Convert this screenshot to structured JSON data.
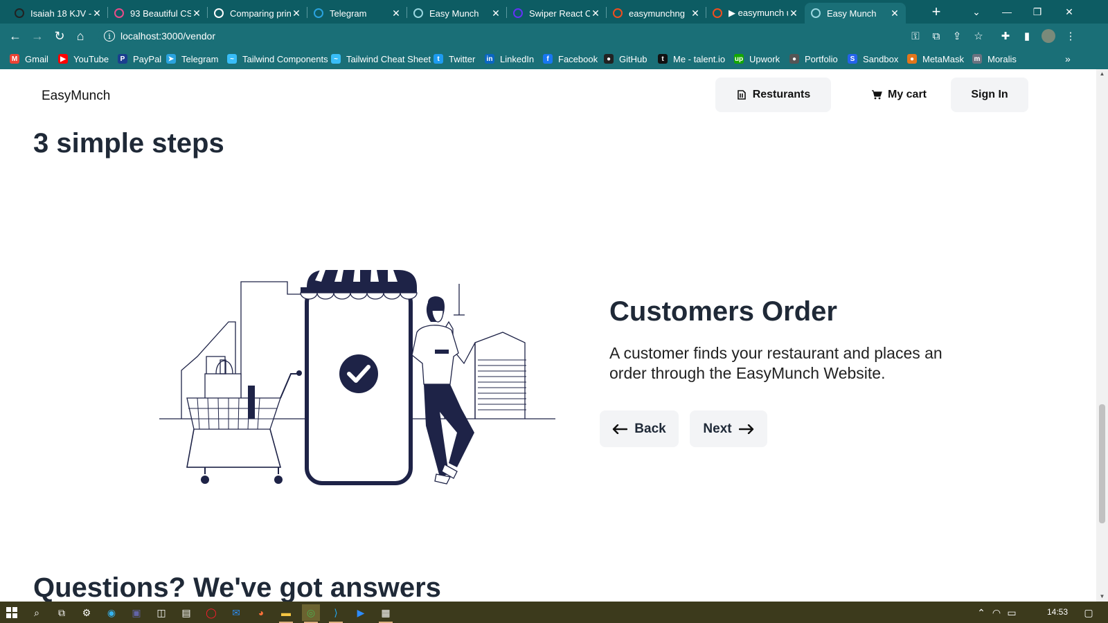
{
  "browser": {
    "tabs": [
      {
        "title": "Isaiah 18 KJV - ",
        "favicon": "headphones-icon",
        "color": "#222222"
      },
      {
        "title": "93 Beautiful CS",
        "favicon": "dribbble-icon",
        "color": "#ea4c89"
      },
      {
        "title": "Comparing prin",
        "favicon": "github-icon",
        "color": "#ffffff"
      },
      {
        "title": "Telegram",
        "favicon": "telegram-icon",
        "color": "#2aa3df"
      },
      {
        "title": "Easy Munch",
        "favicon": "react-icon",
        "color": "#9ad7e0"
      },
      {
        "title": "Swiper React Co",
        "favicon": "swiper-icon",
        "color": "#6332f6"
      },
      {
        "title": "easymunchng",
        "favicon": "figma-icon",
        "color": "#f24e1e"
      },
      {
        "title": "▶ easymunch u",
        "favicon": "figma-icon",
        "color": "#f24e1e"
      },
      {
        "title": "Easy Munch",
        "favicon": "react-icon",
        "color": "#9ad7e0",
        "active": true
      }
    ],
    "url": "localhost:3000/vendor",
    "bookmarks": [
      {
        "label": "Gmail",
        "icon": "gmail-icon",
        "color": "#ea4335",
        "glyph": "M"
      },
      {
        "label": "YouTube",
        "icon": "youtube-icon",
        "color": "#ff0000",
        "glyph": "▶"
      },
      {
        "label": "PayPal",
        "icon": "paypal-icon",
        "color": "#1a3f8f",
        "glyph": "P"
      },
      {
        "label": "Telegram",
        "icon": "telegram-icon",
        "color": "#2aa3df",
        "glyph": "➤"
      },
      {
        "label": "Tailwind Components",
        "icon": "tailwind-icon",
        "color": "#38bdf8",
        "glyph": "~"
      },
      {
        "label": "Tailwind Cheat Sheet",
        "icon": "tailwind-icon",
        "color": "#38bdf8",
        "glyph": "~"
      },
      {
        "label": "Twitter",
        "icon": "twitter-icon",
        "color": "#1d9bf0",
        "glyph": "t"
      },
      {
        "label": "LinkedIn",
        "icon": "linkedin-icon",
        "color": "#0a66c2",
        "glyph": "in"
      },
      {
        "label": "Facebook",
        "icon": "facebook-icon",
        "color": "#1877f2",
        "glyph": "f"
      },
      {
        "label": "GitHub",
        "icon": "github-icon",
        "color": "#222222",
        "glyph": "●"
      },
      {
        "label": "Me - talent.io",
        "icon": "talentio-icon",
        "color": "#111111",
        "glyph": "t"
      },
      {
        "label": "Upwork",
        "icon": "upwork-icon",
        "color": "#14a800",
        "glyph": "up"
      },
      {
        "label": "Portfolio",
        "icon": "portfolio-icon",
        "color": "#555555",
        "glyph": "●"
      },
      {
        "label": "Sandbox",
        "icon": "codesandbox-icon",
        "color": "#2563eb",
        "glyph": "S"
      },
      {
        "label": "MetaMask",
        "icon": "metamask-icon",
        "color": "#e2761b",
        "glyph": "●"
      },
      {
        "label": "Moralis",
        "icon": "moralis-icon",
        "color": "#6b7280",
        "glyph": "m"
      }
    ]
  },
  "page": {
    "brand": "EasyMunch",
    "nav": {
      "restaurants": "Resturants",
      "cart": "My cart",
      "signin": "Sign In"
    },
    "section_title": "3 simple steps",
    "step": {
      "title": "Customers Order",
      "description": "A customer finds your restaurant and places an order through the EasyMunch Website.",
      "back": "Back",
      "next": "Next"
    },
    "next_section_title": "Questions? We've got answers",
    "colors": {
      "navy": "#1e2347",
      "button_bg": "#f3f4f6",
      "browser_frame": "#0d5c63"
    }
  },
  "taskbar": {
    "time": "14:53"
  }
}
